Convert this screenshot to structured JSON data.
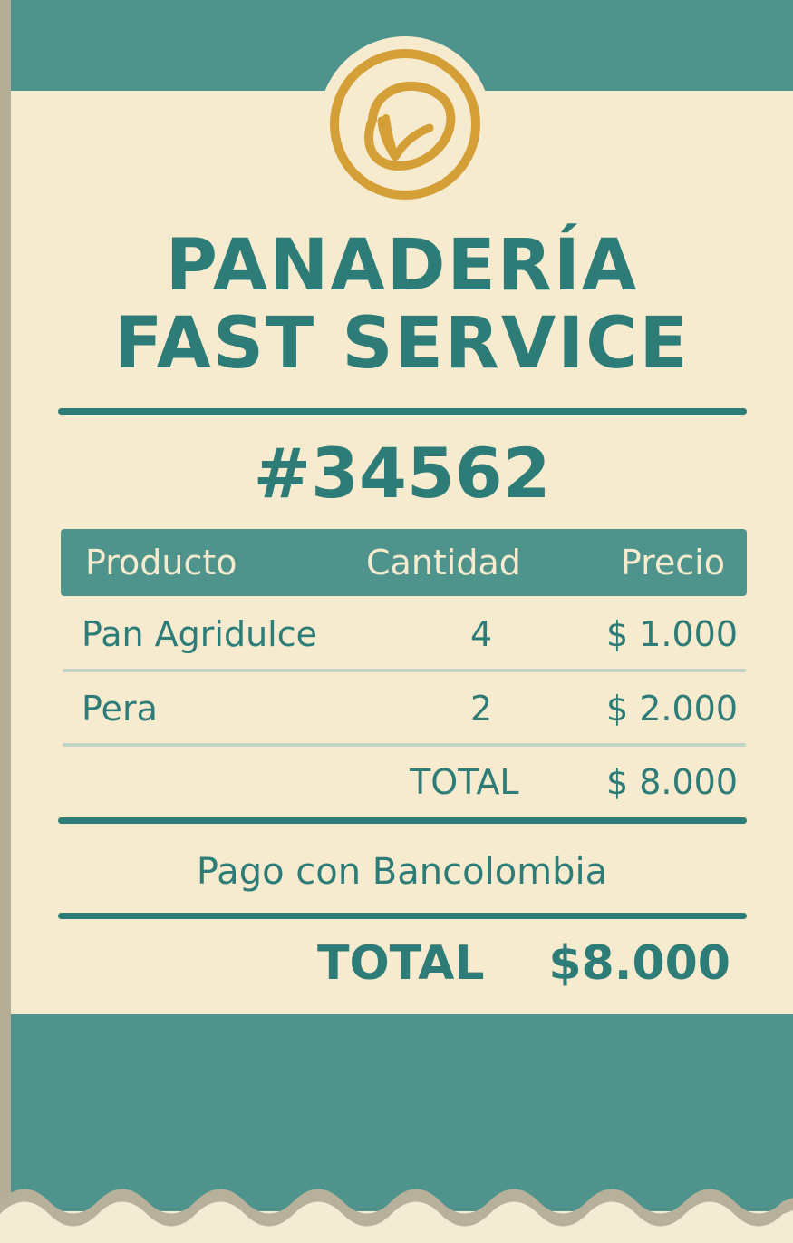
{
  "receipt": {
    "shop_name_line1": "PANADERÍA",
    "shop_name_line2": "FAST SERVICE",
    "order_number": "#34562",
    "columns": {
      "product": "Producto",
      "quantity": "Cantidad",
      "price": "Precio"
    },
    "items": [
      {
        "product": "Pan Agridulce",
        "quantity": "4",
        "price": "$ 1.000"
      },
      {
        "product": "Pera",
        "quantity": "2",
        "price": "$ 2.000"
      }
    ],
    "subtotal": {
      "label": "TOTAL",
      "value": "$ 8.000"
    },
    "payment_method": "Pago con Bancolombia",
    "grand_total": {
      "label": "TOTAL",
      "value": "$8.000"
    }
  },
  "icons": {
    "logo": "leaf-icon"
  },
  "colors": {
    "primary": "#2e7c78",
    "band": "#4e938c",
    "paper": "#f6ebce",
    "gold": "#d59f37"
  }
}
